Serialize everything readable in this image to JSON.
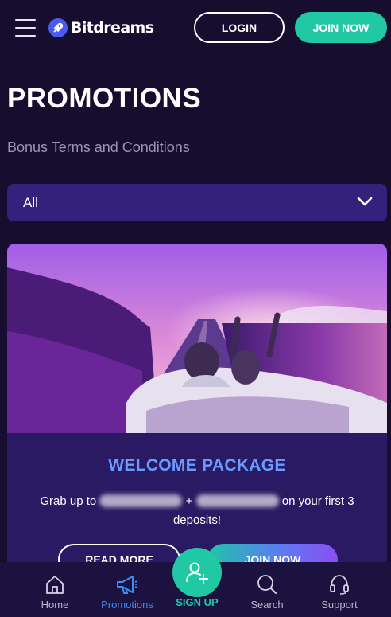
{
  "header": {
    "brand": "Bitdreams",
    "login_label": "LOGIN",
    "join_label": "JOIN NOW"
  },
  "page": {
    "title": "PROMOTIONS",
    "terms_link": "Bonus Terms and Conditions"
  },
  "filter": {
    "selected": "All"
  },
  "promo": {
    "title": "WELCOME PACKAGE",
    "desc_prefix": "Grab up to",
    "desc_plus": "+",
    "desc_suffix": "on your first 3",
    "desc_line2": "deposits!",
    "read_more_label": "READ MORE",
    "join_label": "JOIN NOW"
  },
  "bottom_nav": {
    "home": "Home",
    "promotions": "Promotions",
    "signup": "SIGN UP",
    "search": "Search",
    "support": "Support"
  },
  "colors": {
    "background": "#160d2f",
    "accent_teal": "#20c9a4",
    "filter_bg": "#34217c",
    "card_bg": "#2a1a63",
    "promo_title": "#6a9bff",
    "nav_active": "#3f8df0"
  }
}
